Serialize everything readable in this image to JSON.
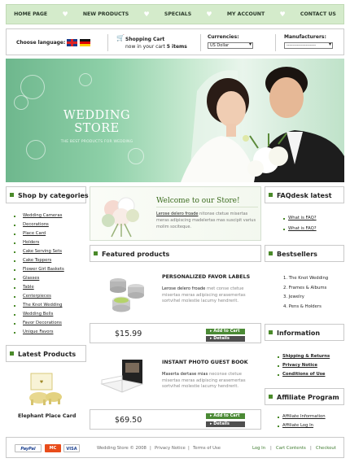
{
  "nav": {
    "items": [
      "HOME PAGE",
      "NEW PRODUCTS",
      "SPECIALS",
      "MY ACCOUNT",
      "CONTACT US"
    ]
  },
  "utility": {
    "language_label": "Choose language:",
    "cart_title": "Shopping Cart",
    "cart_count_text": "now in your cart",
    "cart_count_value": "5 items",
    "currencies_label": "Currencies:",
    "currency_value": "US Dollar",
    "manufacturers_label": "Manufacturers:",
    "manufacturer_value": "--------------------"
  },
  "hero": {
    "title_line1": "WEDDING",
    "title_line2": "STORE",
    "subtitle": "THE BEST PRODUCTS FOR WEDDING"
  },
  "categories": {
    "title": "Shop by categories",
    "items": [
      "Wedding Cameras",
      "Decorations",
      "Place Card",
      "Holders",
      "Cake Serving Sets",
      "Cake Toppers",
      "Flower Girl Baskets",
      "Glasses",
      "Table",
      "Centerpieces",
      "The Knot Wedding",
      "Wedding Bells",
      "Favor Decorations",
      "Unique Favors"
    ]
  },
  "latest": {
    "title": "Latest Products",
    "product_name": "Elephant Place Card"
  },
  "welcome": {
    "title": "Welcome to our Store!",
    "text_strong": "Lerose delero froade",
    "text_rest": "nitonse ctetue misertas meras adipiscing madelertas mas suscipit varius molim sociteque."
  },
  "featured": {
    "title": "Featured products",
    "products": [
      {
        "name": "PERSONALIZED FAVOR LABELS",
        "desc_strong": "Lerose delero froade",
        "desc_rest": "met conse ctetue misertas meras adipiscing erasemertas sortvihel molestie lacumy hendrerit.",
        "price": "$15.99",
        "add_label": "Add to Cart",
        "details_label": "Details"
      },
      {
        "name": "INSTANT PHOTO GUEST BOOK",
        "desc_strong": "Maserta dertase mias",
        "desc_rest": "neconse ctetue misertas meras adipiscing erasemertas sortvihel molestie lacumy hendrerit.",
        "price": "$69.50",
        "add_label": "Add to Cart",
        "details_label": "Details"
      }
    ]
  },
  "faq": {
    "title": "FAQdesk latest",
    "items": [
      "What is FAQ?",
      "What is FAQ?"
    ]
  },
  "bestsellers": {
    "title": "Bestsellers",
    "items": [
      "1. The Knot Wedding",
      "2. Frames & Albums",
      "3. Jewelry",
      "4. Pens & Holders"
    ]
  },
  "information": {
    "title": "Information",
    "items": [
      "Shipping & Returns",
      "Privacy Notice",
      "Conditions of Use"
    ]
  },
  "affiliate": {
    "title": "Affiliate Program",
    "items": [
      "Affiliate Information",
      "Affiliate Log In"
    ]
  },
  "footer": {
    "paypal": "PayPal",
    "mastercard": "MC",
    "visa": "VISA",
    "copyright": "Wedding Store © 2008",
    "privacy": "Privacy Notice",
    "terms": "Terms of Use",
    "login": "Log In",
    "cart_contents": "Cart Contents",
    "checkout": "Checkout"
  },
  "colors": {
    "accent": "#4b8a35",
    "nav_bg": "#d4ebcb",
    "hero_green": "#8ed0a8"
  }
}
